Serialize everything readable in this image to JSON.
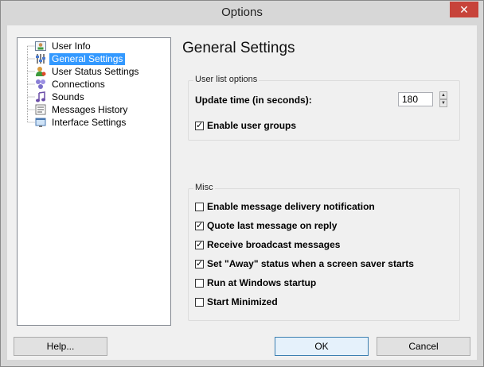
{
  "window": {
    "title": "Options",
    "close_glyph": "✕"
  },
  "tree": {
    "items": [
      {
        "label": "User Info",
        "icon": "user-info-icon",
        "selected": false
      },
      {
        "label": "General Settings",
        "icon": "general-settings-icon",
        "selected": true
      },
      {
        "label": "User Status Settings",
        "icon": "user-status-icon",
        "selected": false
      },
      {
        "label": "Connections",
        "icon": "connections-icon",
        "selected": false
      },
      {
        "label": "Sounds",
        "icon": "sounds-icon",
        "selected": false
      },
      {
        "label": "Messages History",
        "icon": "messages-history-icon",
        "selected": false
      },
      {
        "label": "Interface Settings",
        "icon": "interface-settings-icon",
        "selected": false
      }
    ]
  },
  "panel": {
    "heading": "General Settings",
    "user_list_group": {
      "title": "User list options",
      "update_time_label": "Update time (in seconds):",
      "update_time_value": "180",
      "enable_groups_label": "Enable user groups",
      "enable_groups_checked": true
    },
    "misc_group": {
      "title": "Misc",
      "options": [
        {
          "label": "Enable message delivery notification",
          "checked": false
        },
        {
          "label": "Quote last message on reply",
          "checked": true
        },
        {
          "label": "Receive broadcast messages",
          "checked": true
        },
        {
          "label": "Set \"Away\" status when a screen saver starts",
          "checked": true
        },
        {
          "label": "Run at Windows startup",
          "checked": false
        },
        {
          "label": "Start Minimized",
          "checked": false
        }
      ]
    }
  },
  "buttons": {
    "help": "Help...",
    "ok": "OK",
    "cancel": "Cancel"
  }
}
